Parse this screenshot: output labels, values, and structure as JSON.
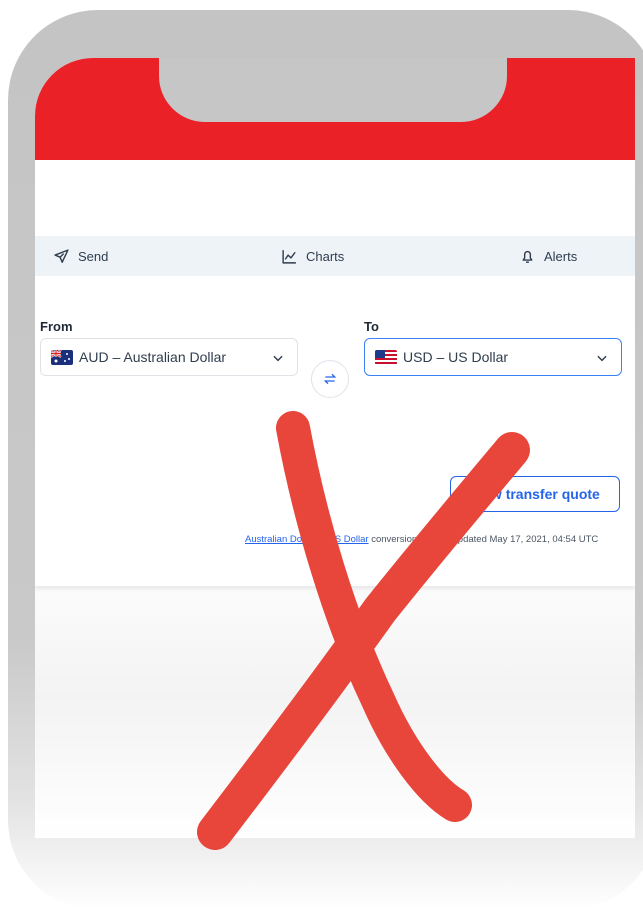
{
  "tabs": [
    {
      "label": "Send",
      "icon": "send-icon"
    },
    {
      "label": "Charts",
      "icon": "chart-icon"
    },
    {
      "label": "Alerts",
      "icon": "bell-icon"
    }
  ],
  "converter": {
    "from_label": "From",
    "to_label": "To",
    "from_value": "AUD – Australian Dollar",
    "to_value": "USD – US Dollar",
    "from_flag": "australia-flag-icon",
    "to_flag": "usa-flag-icon",
    "quote_button": "View transfer quote",
    "footnote": {
      "link1": "Australian Dollar",
      "link2": "US Dollar",
      "mid": " to ",
      "text": " conversion — Last updated May 17, 2021, 04:54 UTC"
    }
  },
  "colors": {
    "header_red": "#ea2228",
    "accent_blue": "#2563eb",
    "x_mark_red": "#e8453b"
  }
}
